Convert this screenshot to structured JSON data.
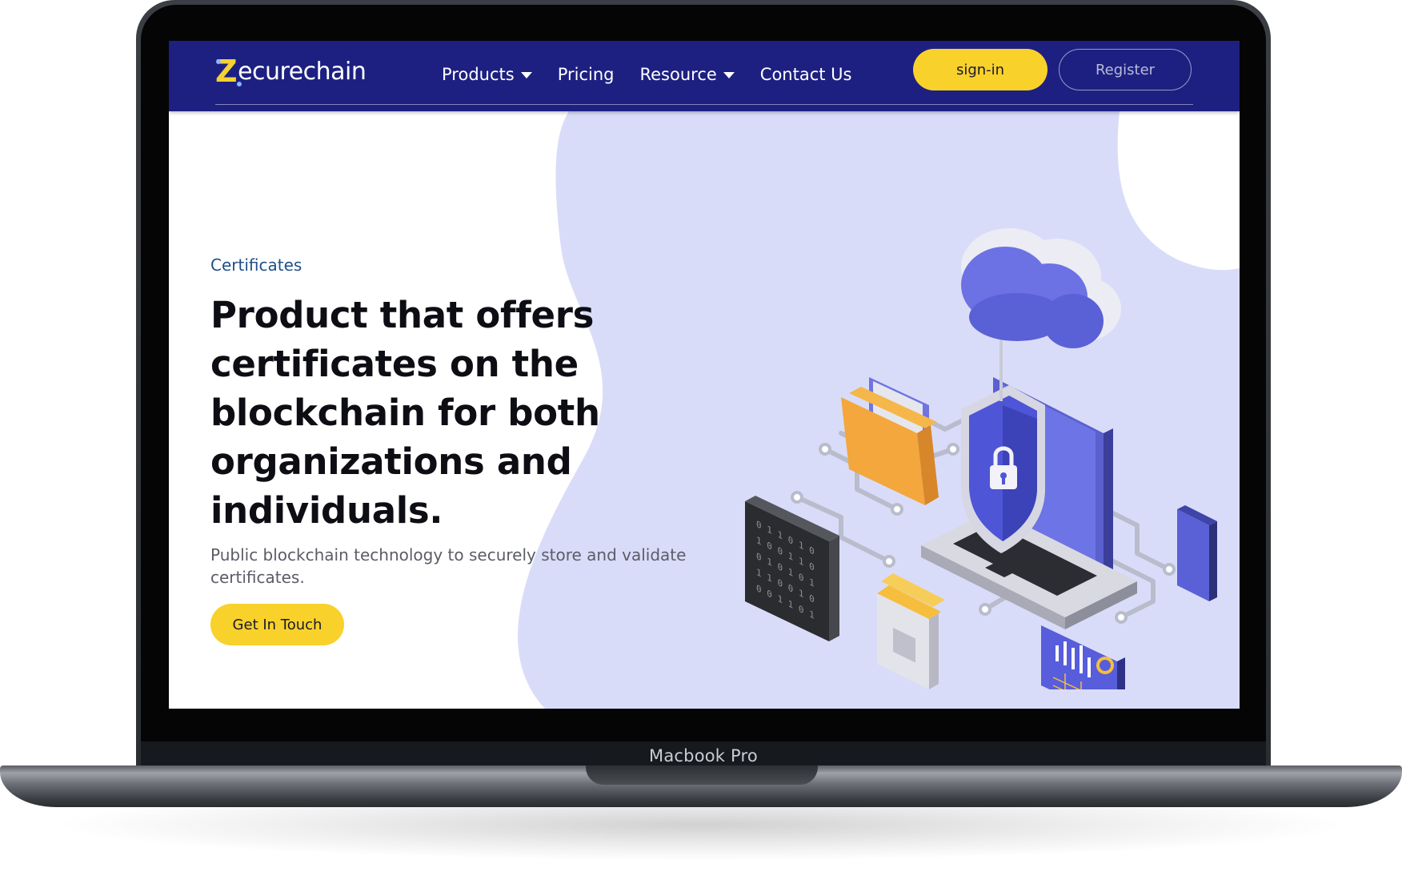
{
  "device": {
    "label": "Macbook Pro"
  },
  "header": {
    "logo_initial": "Z",
    "logo_rest": "ecurechain",
    "nav": [
      {
        "label": "Products",
        "has_dropdown": true
      },
      {
        "label": "Pricing",
        "has_dropdown": false
      },
      {
        "label": "Resource",
        "has_dropdown": true
      },
      {
        "label": "Contact Us",
        "has_dropdown": false
      }
    ],
    "signin_label": "sign-in",
    "register_label": "Register"
  },
  "hero": {
    "eyebrow": "Certificates",
    "headline": "Product that offers certificates on the blockchain for both organizations and individuals.",
    "subcopy": "Public blockchain technology to securely store and validate certificates.",
    "cta_label": "Get In Touch"
  },
  "colors": {
    "header_bg": "#1d2081",
    "accent_yellow": "#f8d12a",
    "blob_lavender": "#d9dcf9",
    "eyebrow_blue": "#1f4f8a",
    "headline": "#0d0d14"
  },
  "icons": [
    "caret-down-icon",
    "cloud-icon",
    "shield-lock-icon",
    "laptop-icon",
    "folder-icon",
    "binary-tablet-icon",
    "phone-icon",
    "chart-tablet-icon",
    "document-icon"
  ]
}
